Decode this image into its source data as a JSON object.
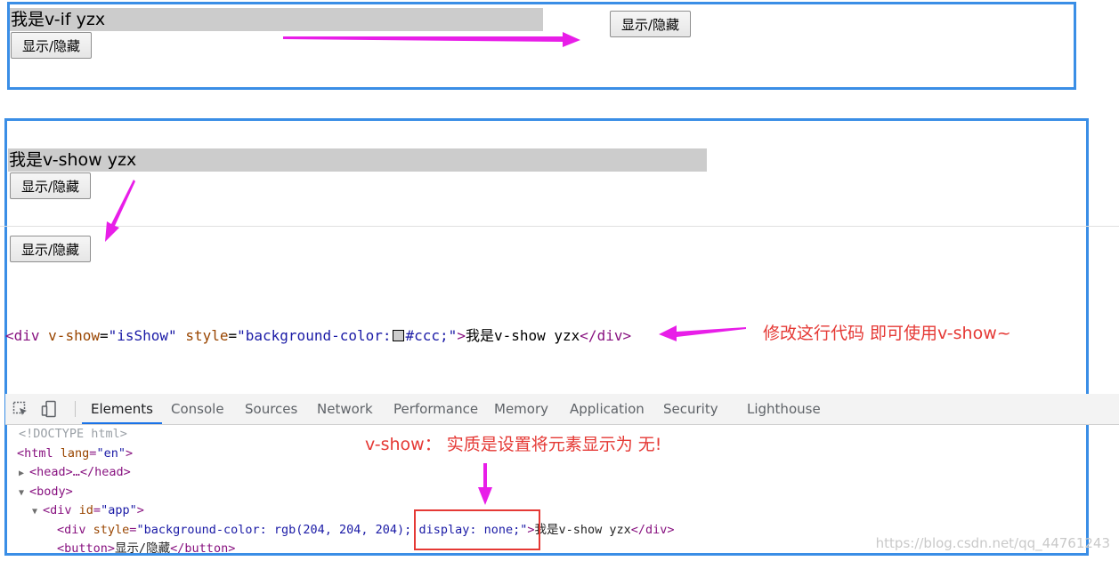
{
  "vif_section": {
    "text": "我是v-if yzx",
    "button_left": "显示/隐藏",
    "button_right": "显示/隐藏"
  },
  "vshow_section": {
    "text": "我是v-show yzx",
    "button_top": "显示/隐藏",
    "button_bottom": "显示/隐藏"
  },
  "code_line": {
    "open_tag": "<div",
    "attr1_name": "v-show",
    "eq1": "=",
    "attr1_value": "\"isShow\"",
    "attr2_name": "style",
    "eq2": "=",
    "attr2_value_pre": "\"background-color:",
    "attr2_value_post": "#ccc;\"",
    "close_open": ">",
    "content": "我是v-show yzx",
    "close_tag": "</div>"
  },
  "annotations": {
    "modify_note": "修改这行代码 即可使用v-show~",
    "vshow_note": "v-show： 实质是设置将元素显示为 无!"
  },
  "devtools": {
    "tabs": [
      "Elements",
      "Console",
      "Sources",
      "Network",
      "Performance",
      "Memory",
      "Application",
      "Security",
      "Lighthouse"
    ],
    "active_tab": "Elements",
    "dom": {
      "doctype": "<!DOCTYPE html>",
      "html_open": "<html",
      "html_attr": "lang",
      "html_attr_val": "\"en\"",
      "head": "<head>…</head>",
      "body_open": "<body>",
      "div_open": "<div",
      "div_attr": "id",
      "div_attr_val": "\"app\"",
      "inner_div_open": "<div",
      "inner_div_attr": "style",
      "inner_div_style_a": "\"background-color: rgb(204, 204, 204);",
      "inner_div_style_b": "display: none;\"",
      "inner_div_text": "我是v-show yzx",
      "inner_div_close": "</div>",
      "button_open": "<button>",
      "button_text": "显示/隐藏",
      "button_close": "</button>"
    }
  },
  "watermark": "https://blog.csdn.net/qq_44761243",
  "colors": {
    "frame_blue": "#3a8ee6",
    "arrow_magenta": "#e81ee8",
    "note_red": "#e53935",
    "gray_bar": "#cccccc"
  },
  "icons": [
    "inspect-element-icon",
    "device-toolbar-icon"
  ]
}
